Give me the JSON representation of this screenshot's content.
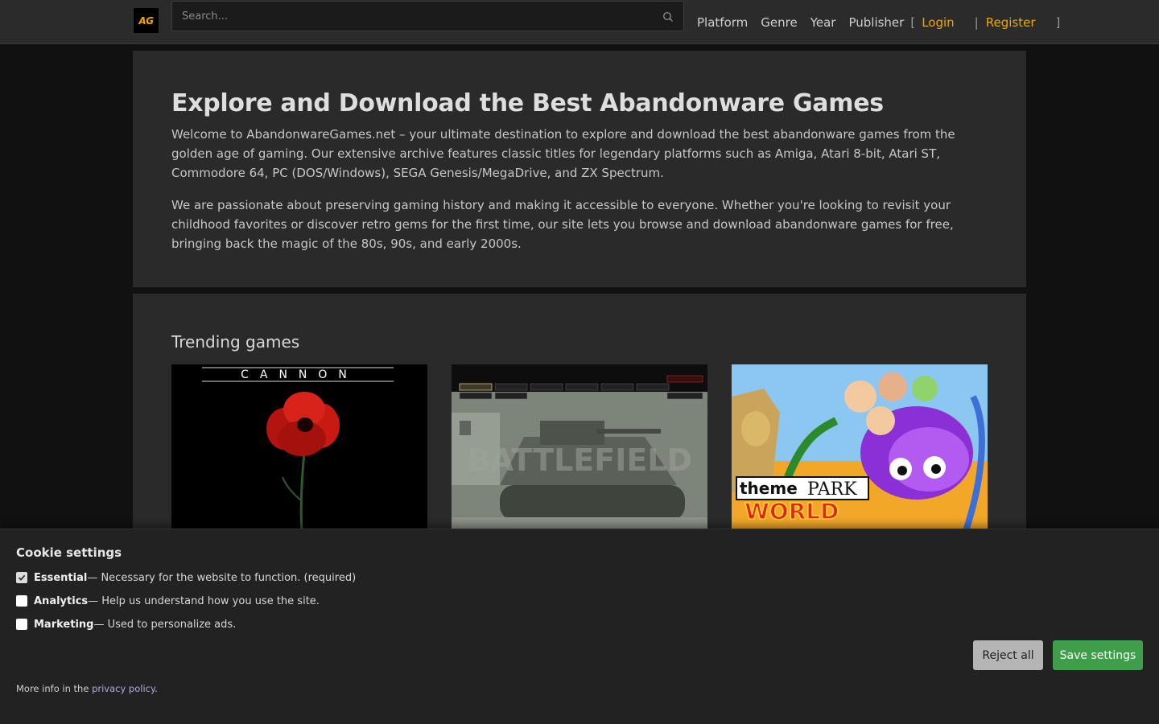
{
  "header": {
    "logo_text": "AG",
    "search_placeholder": "Search...",
    "nav": [
      "Platform",
      "Genre",
      "Year",
      "Publisher"
    ],
    "bracket_open": "[",
    "bracket_close": "]",
    "separator": "|",
    "login": "Login",
    "register": "Register"
  },
  "hero": {
    "title": "Explore and Download the Best Abandonware Games",
    "paragraph1": "Welcome to AbandonwareGames.net – your ultimate destination to explore and download the best abandonware games from the golden age of gaming. Our extensive archive features classic titles for legendary platforms such as Amiga, Atari 8-bit, Atari ST, Commodore 64, PC (DOS/Windows), SEGA Genesis/MegaDrive, and ZX Spectrum.",
    "paragraph2": "We are passionate about preserving gaming history and making it accessible to everyone. Whether you're looking to revisit your childhood favorites or discover retro gems for the first time, our site lets you browse and download abandonware games for free, bringing back the magic of the 80s, 90s, and early 2000s."
  },
  "trending": {
    "title": "Trending games",
    "cards": [
      {
        "title_art": "CANNON"
      },
      {
        "title_art": "BATTLEFIELD"
      },
      {
        "title_art_line1": "theme",
        "title_art_line2": "PARK",
        "title_art_line3": "WORLD"
      }
    ]
  },
  "cookie": {
    "title": "Cookie settings",
    "options": [
      {
        "label": "Essential",
        "desc": "— Necessary for the website to function. (required)",
        "checked": true
      },
      {
        "label": "Analytics",
        "desc": "— Help us understand how you use the site.",
        "checked": false
      },
      {
        "label": "Marketing",
        "desc": "— Used to personalize ads.",
        "checked": false
      }
    ],
    "reject_label": "Reject all",
    "save_label": "Save settings",
    "more_prefix": "More info in the ",
    "privacy_link": "privacy policy",
    "more_suffix": "."
  },
  "colors": {
    "accent": "#f0a500",
    "save_button": "#3e9e4a",
    "link": "#b0a8e8"
  }
}
